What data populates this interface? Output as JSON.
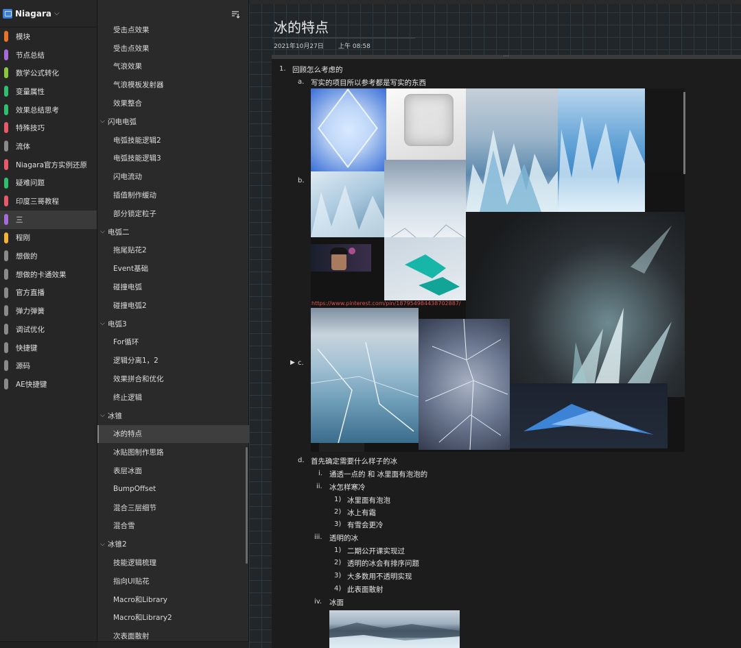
{
  "notebook": {
    "name": "Niagara"
  },
  "sections": [
    {
      "label": "模块",
      "color": "#e8742a"
    },
    {
      "label": "节点总结",
      "color": "#a56cd9"
    },
    {
      "label": "数学公式转化",
      "color": "#8cc63f"
    },
    {
      "label": "变量属性",
      "color": "#2fbf71"
    },
    {
      "label": "效果总结思考",
      "color": "#2fbf71"
    },
    {
      "label": "特殊技巧",
      "color": "#e85a6a"
    },
    {
      "label": "流体",
      "color": "#8a8a8a"
    },
    {
      "label": "Niagara官方实例还原",
      "color": "#e85a6a"
    },
    {
      "label": "疑难问题",
      "color": "#2fbf71"
    },
    {
      "label": "印度三哥教程",
      "color": "#e85a6a"
    },
    {
      "label": "三",
      "color": "#a56cd9",
      "selected": true
    },
    {
      "label": "程刚",
      "color": "#f2b233"
    },
    {
      "label": "想做的",
      "color": "#8a8a8a"
    },
    {
      "label": "想做的卡通效果",
      "color": "#8a8a8a"
    },
    {
      "label": "官方直播",
      "color": "#8a8a8a"
    },
    {
      "label": "弹力弹簧",
      "color": "#8a8a8a"
    },
    {
      "label": "调试优化",
      "color": "#8a8a8a"
    },
    {
      "label": "快捷键",
      "color": "#8a8a8a"
    },
    {
      "label": "源码",
      "color": "#8a8a8a"
    },
    {
      "label": "AE快捷键",
      "color": "#8a8a8a"
    }
  ],
  "pages": [
    {
      "label": "受击点效果",
      "kind": "child"
    },
    {
      "label": "受击点效果",
      "kind": "child"
    },
    {
      "label": "气浪效果",
      "kind": "child"
    },
    {
      "label": "气浪模板发射器",
      "kind": "child"
    },
    {
      "label": "效果整合",
      "kind": "child"
    },
    {
      "label": "闪电电弧",
      "kind": "group"
    },
    {
      "label": "电弧技能逻辑2",
      "kind": "child"
    },
    {
      "label": "电弧技能逻辑3",
      "kind": "child"
    },
    {
      "label": "闪电流动",
      "kind": "child"
    },
    {
      "label": "插值制作缓动",
      "kind": "child"
    },
    {
      "label": "部分锁定粒子",
      "kind": "child"
    },
    {
      "label": "电弧二",
      "kind": "group"
    },
    {
      "label": "拖尾贴花2",
      "kind": "child"
    },
    {
      "label": "Event基础",
      "kind": "child"
    },
    {
      "label": "碰撞电弧",
      "kind": "child"
    },
    {
      "label": "碰撞电弧2",
      "kind": "child"
    },
    {
      "label": "电弧3",
      "kind": "group"
    },
    {
      "label": "For循环",
      "kind": "child"
    },
    {
      "label": "逻辑分离1，2",
      "kind": "child"
    },
    {
      "label": "效果拼合和优化",
      "kind": "child"
    },
    {
      "label": "终止逻辑",
      "kind": "child"
    },
    {
      "label": "冰锥",
      "kind": "group"
    },
    {
      "label": "冰的特点",
      "kind": "child",
      "selected": true
    },
    {
      "label": "冰贴图制作思路",
      "kind": "child"
    },
    {
      "label": "表层冰面",
      "kind": "child"
    },
    {
      "label": "BumpOffset",
      "kind": "child"
    },
    {
      "label": "混合三层细节",
      "kind": "child"
    },
    {
      "label": "混合雪",
      "kind": "child"
    },
    {
      "label": "冰锥2",
      "kind": "group"
    },
    {
      "label": "技能逻辑梳理",
      "kind": "child"
    },
    {
      "label": "指向UI贴花",
      "kind": "child"
    },
    {
      "label": "Macro和Library",
      "kind": "child"
    },
    {
      "label": "Macro和Library2",
      "kind": "child"
    },
    {
      "label": "次表面散射",
      "kind": "child"
    }
  ],
  "page": {
    "title": "冰的特点",
    "date": "2021年10月27日",
    "time": "上午 08:58",
    "outline": [
      {
        "marker": "1.",
        "text": "回顾怎么考虑的"
      },
      {
        "marker": "a.",
        "text": "写实的项目所以参考都是写实的东西"
      },
      {
        "marker": "b.",
        "text": ""
      },
      {
        "marker": "c.",
        "text": ""
      },
      {
        "marker": "d.",
        "text": "首先确定需要什么样子的冰"
      },
      {
        "marker": "i.",
        "text": "通透一点的 和 冰里面有泡泡的"
      },
      {
        "marker": "ii.",
        "text": "冰怎样寒冷"
      },
      {
        "marker": "1)",
        "text": "冰里面有泡泡"
      },
      {
        "marker": "2)",
        "text": "冰上有霜"
      },
      {
        "marker": "3)",
        "text": "有雪会更冷"
      },
      {
        "marker": "iii.",
        "text": "透明的冰"
      },
      {
        "marker": "1)",
        "text": "二期公开课实现过"
      },
      {
        "marker": "2)",
        "text": "透明的冰会有排序问题"
      },
      {
        "marker": "3)",
        "text": "大多数用不透明实现"
      },
      {
        "marker": "4)",
        "text": "此表面散射"
      },
      {
        "marker": "iv.",
        "text": "冰面"
      }
    ],
    "pinterest_url": "https://www.pinterest.com/pin/187954984438702887/",
    "images": [
      "blue-ice-cube-photo",
      "clear-ice-cube-photo",
      "glacier-ice-photo",
      "blue-glacier-wall-photo",
      "ice-shards-photo",
      "frozen-lake-photo",
      "teal-ice-chunks-photo",
      "webcam-overlay-presenter",
      "ice-crystal-concept-art",
      "cracked-ice-lake-photo",
      "frost-vein-texture",
      "blue-ice-spike-art",
      "frozen-shore-photo"
    ]
  }
}
